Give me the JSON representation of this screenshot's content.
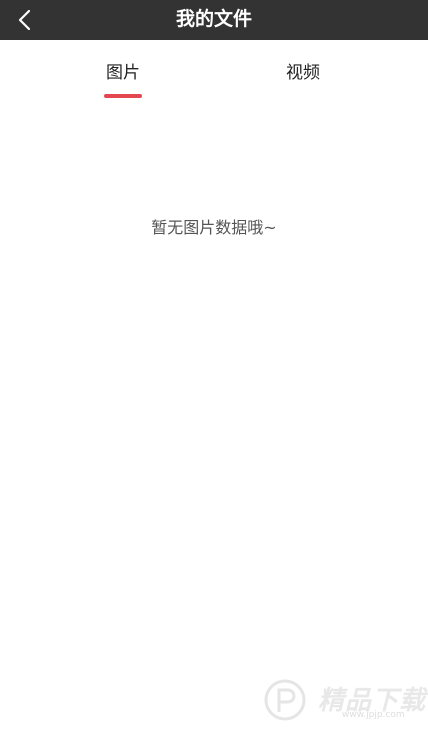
{
  "header": {
    "title": "我的文件",
    "back_icon": "chevron-left-icon",
    "background": "#333333"
  },
  "tabs": [
    {
      "label": "图片",
      "active": true
    },
    {
      "label": "视频",
      "active": false
    }
  ],
  "accent": "#e5474f",
  "empty_state": {
    "message": "暂无图片数据哦~"
  },
  "watermark": {
    "text": "精品下载",
    "url": "www.jpjp.com",
    "icon": "p-logo-icon"
  }
}
